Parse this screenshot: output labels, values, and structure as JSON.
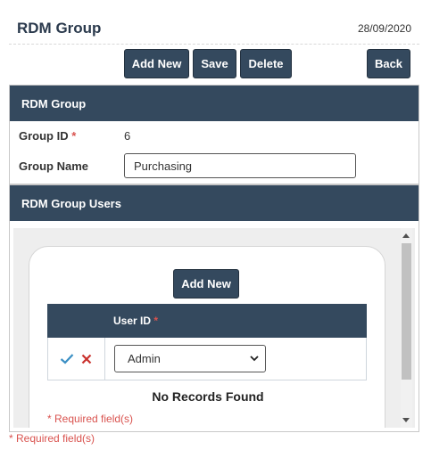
{
  "header": {
    "title": "RDM Group",
    "date": "28/09/2020"
  },
  "toolbar": {
    "add_new": "Add New",
    "save": "Save",
    "delete": "Delete",
    "back": "Back"
  },
  "group_panel": {
    "title": "RDM Group",
    "group_id_label": "Group ID",
    "group_id_value": "6",
    "group_name_label": "Group Name",
    "group_name_value": "Purchasing"
  },
  "users_panel": {
    "title": "RDM Group Users",
    "add_new": "Add New",
    "column_user_id": "User ID",
    "selected_user": "Admin",
    "no_records": "No Records Found",
    "required_note": "* Required field(s)"
  },
  "required_asterisk": "*",
  "footer": {
    "required_note": "* Required field(s)"
  },
  "colors": {
    "header": "#34495e",
    "required": "#d9534f",
    "check": "#3a8fc4",
    "cross": "#c9302c"
  },
  "icons": {
    "confirm": "check-icon",
    "cancel": "close-icon",
    "dropdown": "chevron-down-icon"
  }
}
